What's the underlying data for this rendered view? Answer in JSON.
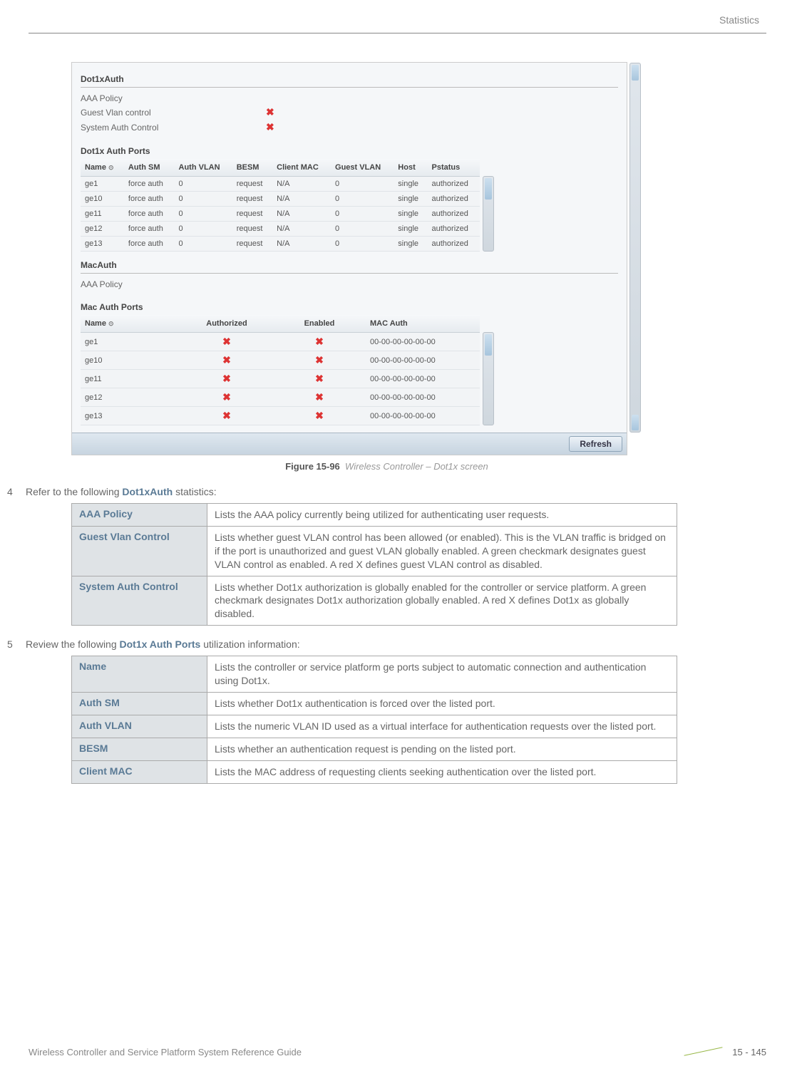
{
  "header": {
    "topic": "Statistics"
  },
  "screenshot": {
    "dot1xauth": {
      "title": "Dot1xAuth",
      "aaa_policy": "AAA Policy",
      "guest_vlan_control": "Guest Vlan control",
      "system_auth_control": "System Auth Control"
    },
    "authports": {
      "title": "Dot1x Auth Ports",
      "headers": {
        "name": "Name",
        "authsm": "Auth SM",
        "authvlan": "Auth VLAN",
        "besm": "BESM",
        "clientmac": "Client MAC",
        "guestvlan": "Guest VLAN",
        "host": "Host",
        "pstatus": "Pstatus"
      },
      "rows": [
        {
          "name": "ge1",
          "authsm": "force auth",
          "authvlan": "0",
          "besm": "request",
          "clientmac": "N/A",
          "guestvlan": "0",
          "host": "single",
          "pstatus": "authorized"
        },
        {
          "name": "ge10",
          "authsm": "force auth",
          "authvlan": "0",
          "besm": "request",
          "clientmac": "N/A",
          "guestvlan": "0",
          "host": "single",
          "pstatus": "authorized"
        },
        {
          "name": "ge11",
          "authsm": "force auth",
          "authvlan": "0",
          "besm": "request",
          "clientmac": "N/A",
          "guestvlan": "0",
          "host": "single",
          "pstatus": "authorized"
        },
        {
          "name": "ge12",
          "authsm": "force auth",
          "authvlan": "0",
          "besm": "request",
          "clientmac": "N/A",
          "guestvlan": "0",
          "host": "single",
          "pstatus": "authorized"
        },
        {
          "name": "ge13",
          "authsm": "force auth",
          "authvlan": "0",
          "besm": "request",
          "clientmac": "N/A",
          "guestvlan": "0",
          "host": "single",
          "pstatus": "authorized"
        }
      ]
    },
    "macauth": {
      "title": "MacAuth",
      "aaa_policy": "AAA Policy"
    },
    "macports": {
      "title": "Mac Auth Ports",
      "headers": {
        "name": "Name",
        "authorized": "Authorized",
        "enabled": "Enabled",
        "macauth": "MAC Auth"
      },
      "rows": [
        {
          "name": "ge1",
          "mac": "00-00-00-00-00-00"
        },
        {
          "name": "ge10",
          "mac": "00-00-00-00-00-00"
        },
        {
          "name": "ge11",
          "mac": "00-00-00-00-00-00"
        },
        {
          "name": "ge12",
          "mac": "00-00-00-00-00-00"
        },
        {
          "name": "ge13",
          "mac": "00-00-00-00-00-00"
        }
      ]
    },
    "refresh": "Refresh"
  },
  "figure": {
    "label": "Figure 15-96",
    "desc": "Wireless Controller – Dot1x screen"
  },
  "steps": {
    "s4": {
      "num": "4",
      "pre": "Refer to the following ",
      "bold": "Dot1xAuth",
      "post": " statistics:"
    },
    "s5": {
      "num": "5",
      "pre": "Review the following ",
      "bold": "Dot1x Auth Ports",
      "post": " utilization information:"
    }
  },
  "table1": [
    {
      "term": "AAA Policy",
      "desc": "Lists the AAA policy currently being utilized for authenticating user requests."
    },
    {
      "term": "Guest Vlan Control",
      "desc": "Lists whether guest VLAN control has been allowed (or enabled). This is the VLAN traffic is bridged on if the port is unauthorized and guest VLAN globally enabled. A green checkmark designates guest VLAN control as enabled. A red X defines guest VLAN control as disabled."
    },
    {
      "term": "System Auth Control",
      "desc": "Lists whether Dot1x authorization is globally enabled for the controller or service platform. A green checkmark designates Dot1x authorization globally enabled. A red X defines Dot1x as globally disabled."
    }
  ],
  "table2": [
    {
      "term": "Name",
      "desc": "Lists the controller or service platform ge ports subject to automatic connection and authentication using Dot1x."
    },
    {
      "term": "Auth SM",
      "desc": "Lists whether Dot1x authentication is forced over the listed port."
    },
    {
      "term": "Auth VLAN",
      "desc": "Lists the numeric VLAN ID used as a virtual interface for authentication requests over the listed port."
    },
    {
      "term": "BESM",
      "desc": "Lists whether an authentication request is pending on the listed port."
    },
    {
      "term": "Client MAC",
      "desc": "Lists the MAC address of requesting clients seeking authentication over the listed port."
    }
  ],
  "footer": {
    "guide": "Wireless Controller and Service Platform System Reference Guide",
    "page": "15 - 145"
  }
}
